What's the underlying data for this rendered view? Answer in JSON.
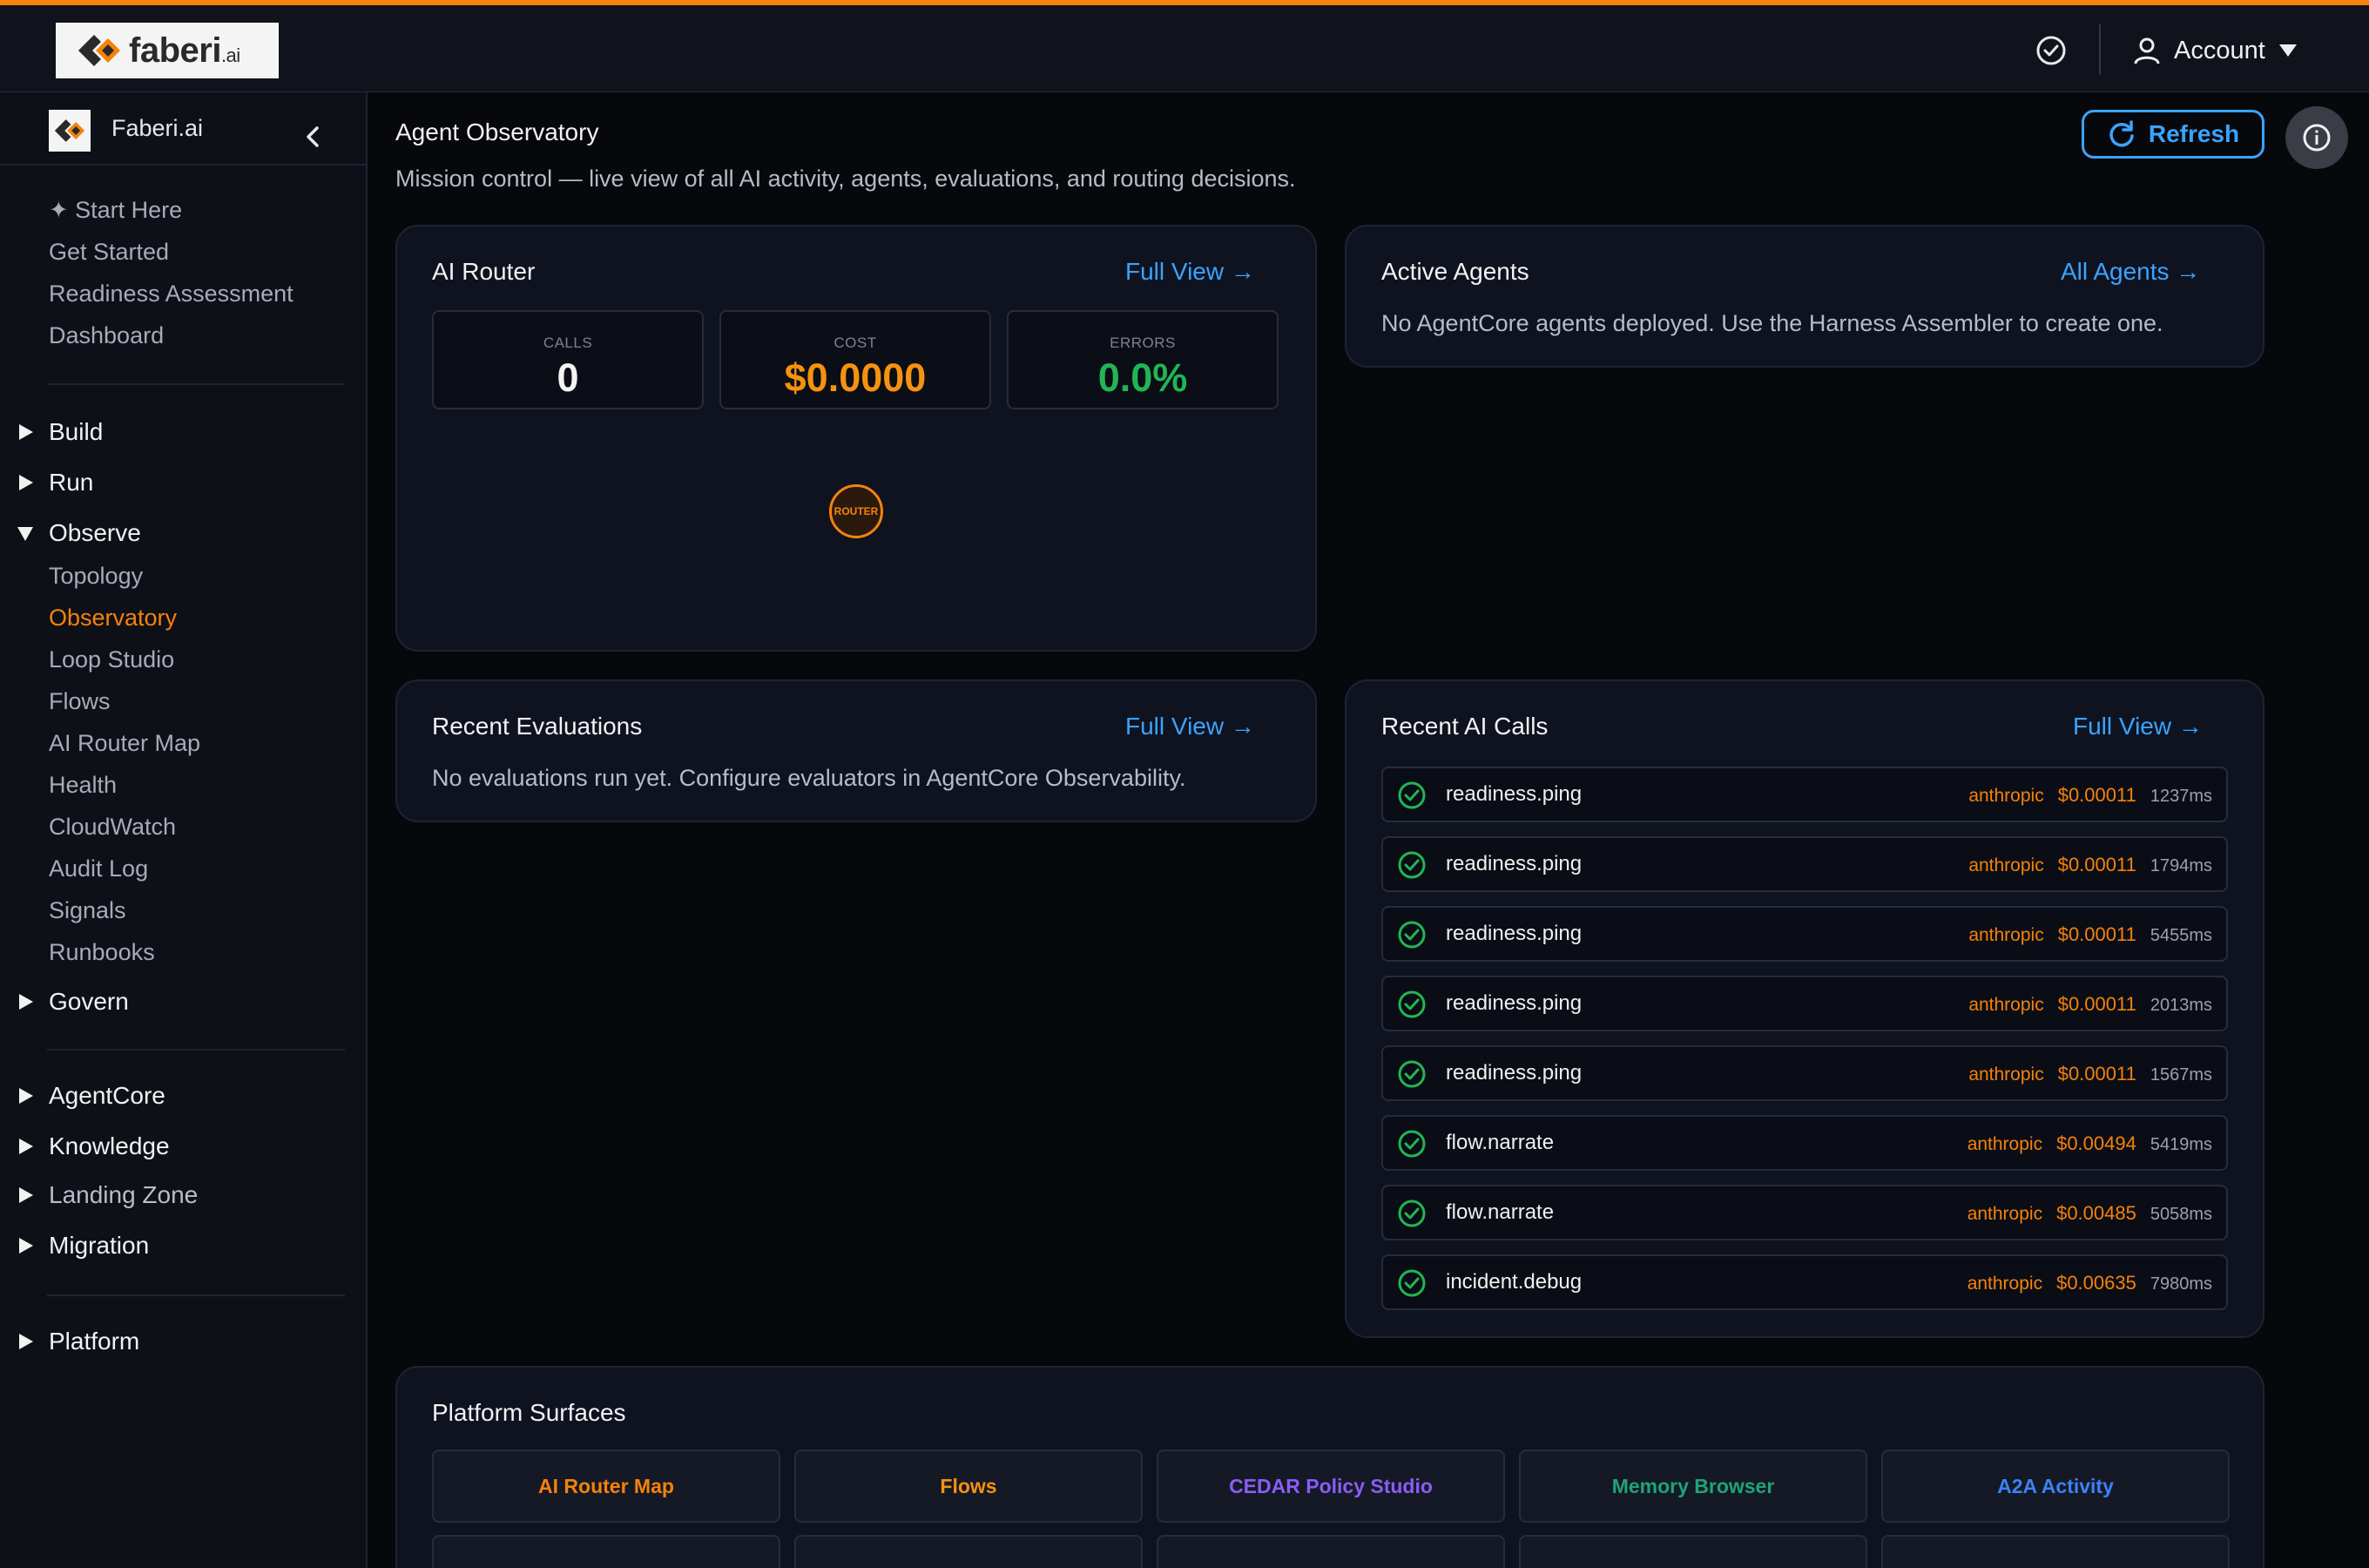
{
  "brand": {
    "name": "faberi",
    "suffix": ".ai",
    "sidebar_title": "Faberi.ai"
  },
  "topbar": {
    "account_label": "Account"
  },
  "sidebar": {
    "quick_links": [
      "✦ Start Here",
      "Get Started",
      "Readiness Assessment",
      "Dashboard"
    ],
    "groups_top": [
      "Build",
      "Run"
    ],
    "observe": {
      "label": "Observe",
      "items": [
        "Topology",
        "Observatory",
        "Loop Studio",
        "Flows",
        "AI Router Map",
        "Health",
        "CloudWatch",
        "Audit Log",
        "Signals",
        "Runbooks"
      ],
      "active": "Observatory"
    },
    "govern": "Govern",
    "groups_mid": [
      "AgentCore",
      "Knowledge",
      "Landing Zone",
      "Migration"
    ],
    "platform": "Platform"
  },
  "page": {
    "title": "Agent Observatory",
    "subtitle": "Mission control — live view of all AI activity, agents, evaluations, and routing decisions.",
    "refresh_label": "Refresh"
  },
  "ai_router": {
    "title": "AI Router",
    "link": "Full View →",
    "stats": [
      {
        "label": "CALLS",
        "value": "0",
        "color": "#f4f4f4"
      },
      {
        "label": "COST",
        "value": "$0.0000",
        "color": "#f5920f"
      },
      {
        "label": "ERRORS",
        "value": "0.0%",
        "color": "#22b554"
      }
    ],
    "node_label": "ROUTER"
  },
  "active_agents": {
    "title": "Active Agents",
    "link": "All Agents →",
    "message": "No AgentCore agents deployed. Use the Harness Assembler to create one."
  },
  "recent_evaluations": {
    "title": "Recent Evaluations",
    "link": "Full View →",
    "message": "No evaluations run yet. Configure evaluators in AgentCore Observability."
  },
  "recent_calls": {
    "title": "Recent AI Calls",
    "link": "Full View →",
    "rows": [
      {
        "name": "readiness.ping",
        "provider": "anthropic",
        "cost": "$0.00011",
        "latency": "1237ms"
      },
      {
        "name": "readiness.ping",
        "provider": "anthropic",
        "cost": "$0.00011",
        "latency": "1794ms"
      },
      {
        "name": "readiness.ping",
        "provider": "anthropic",
        "cost": "$0.00011",
        "latency": "5455ms"
      },
      {
        "name": "readiness.ping",
        "provider": "anthropic",
        "cost": "$0.00011",
        "latency": "2013ms"
      },
      {
        "name": "readiness.ping",
        "provider": "anthropic",
        "cost": "$0.00011",
        "latency": "1567ms"
      },
      {
        "name": "flow.narrate",
        "provider": "anthropic",
        "cost": "$0.00494",
        "latency": "5419ms"
      },
      {
        "name": "flow.narrate",
        "provider": "anthropic",
        "cost": "$0.00485",
        "latency": "5058ms"
      },
      {
        "name": "incident.debug",
        "provider": "anthropic",
        "cost": "$0.00635",
        "latency": "7980ms"
      }
    ]
  },
  "platform_surfaces": {
    "title": "Platform Surfaces",
    "items": [
      {
        "label": "AI Router Map",
        "color": "#f5820b"
      },
      {
        "label": "Flows",
        "color": "#f5920f"
      },
      {
        "label": "CEDAR Policy Studio",
        "color": "#8b5cf6"
      },
      {
        "label": "Memory Browser",
        "color": "#1fa37a"
      },
      {
        "label": "A2A Activity",
        "color": "#3b82f6"
      }
    ],
    "second_row_colors": [
      "#f5820b",
      "#f5920f",
      "#22b554",
      "#cfd3da",
      "#3b82f6"
    ]
  },
  "colors": {
    "accent": "#f5820b",
    "link": "#3ba3ff",
    "success": "#22b554"
  }
}
